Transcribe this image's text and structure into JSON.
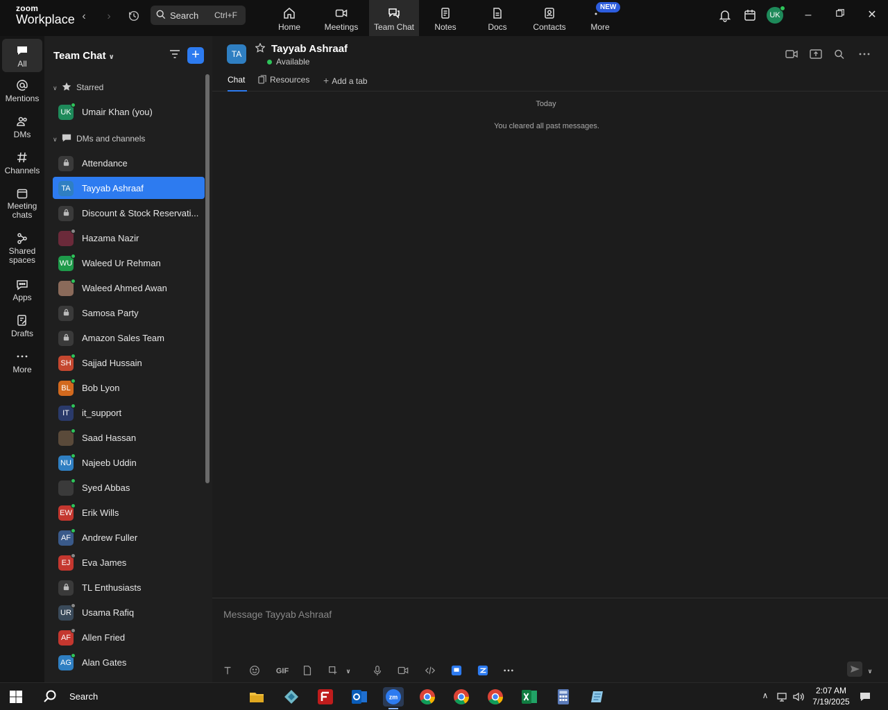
{
  "brand": {
    "line1": "zoom",
    "line2": "Workplace"
  },
  "search": {
    "label": "Search",
    "shortcut": "Ctrl+F"
  },
  "topnav": [
    {
      "label": "Home",
      "icon": "home-icon"
    },
    {
      "label": "Meetings",
      "icon": "video-icon"
    },
    {
      "label": "Team Chat",
      "icon": "chat-icon",
      "active": true
    },
    {
      "label": "Notes",
      "icon": "notes-icon"
    },
    {
      "label": "Docs",
      "icon": "docs-icon"
    },
    {
      "label": "Contacts",
      "icon": "contacts-icon"
    },
    {
      "label": "More",
      "icon": "more-icon"
    }
  ],
  "new_badge": "NEW",
  "user_initials": "UK",
  "rail": [
    {
      "label": "All",
      "icon": "chat-bubble-icon",
      "active": true
    },
    {
      "label": "Mentions",
      "icon": "at-icon"
    },
    {
      "label": "DMs",
      "icon": "people-icon"
    },
    {
      "label": "Channels",
      "icon": "hash-icon"
    },
    {
      "label1": "Meeting",
      "label2": "chats",
      "icon": "calendar-icon"
    },
    {
      "label1": "Shared",
      "label2": "spaces",
      "icon": "share-icon"
    },
    {
      "label": "Apps",
      "icon": "apps-icon"
    },
    {
      "label": "Drafts",
      "icon": "drafts-icon"
    },
    {
      "label": "More",
      "icon": "ellipsis-icon"
    }
  ],
  "list": {
    "title": "Team Chat",
    "starred_label": "Starred",
    "dms_label": "DMs and channels",
    "starred": [
      {
        "name": "Umair Khan (you)",
        "initials": "UK",
        "color": "#1e8a5a",
        "status": "#2ec45a"
      }
    ],
    "items": [
      {
        "name": "Attendance",
        "initials": "",
        "color": "#3a3a3a",
        "type": "channel"
      },
      {
        "name": "Tayyab Ashraaf",
        "initials": "TA",
        "color": "#2f7fc2",
        "selected": true
      },
      {
        "name": "Discount & Stock Reservati...",
        "initials": "",
        "color": "#3a3a3a",
        "type": "channel"
      },
      {
        "name": "Hazama Nazir",
        "initials": "",
        "color": "#6b2a3a",
        "status": "#888888"
      },
      {
        "name": "Waleed Ur Rehman",
        "initials": "WU",
        "color": "#1e9a4a",
        "status": "#2ec45a"
      },
      {
        "name": "Waleed Ahmed Awan",
        "initials": "",
        "color": "#8a6a5a",
        "status": "#2ec45a"
      },
      {
        "name": "Samosa Party",
        "initials": "",
        "color": "#3a3a3a",
        "type": "channel"
      },
      {
        "name": "Amazon Sales Team",
        "initials": "",
        "color": "#3a3a3a",
        "type": "channel"
      },
      {
        "name": "Sajjad Hussain",
        "initials": "SH",
        "color": "#c4472f",
        "status": "#2ec45a"
      },
      {
        "name": "Bob Lyon",
        "initials": "BL",
        "color": "#d2691e",
        "status": "#2ec45a"
      },
      {
        "name": "it_support",
        "initials": "IT",
        "color": "#2a3a6a",
        "status": "#2ec45a"
      },
      {
        "name": "Saad Hassan",
        "initials": "",
        "color": "#5a4a3a",
        "status": "#2ec45a"
      },
      {
        "name": "Najeeb Uddin",
        "initials": "NU",
        "color": "#2f7fc2",
        "status": "#2ec45a"
      },
      {
        "name": "Syed Abbas",
        "initials": "",
        "color": "#3a3a3a",
        "status": "#2ec45a"
      },
      {
        "name": "Erik Wills",
        "initials": "EW",
        "color": "#c4372f",
        "status": "#2ec45a"
      },
      {
        "name": "Andrew Fuller",
        "initials": "AF",
        "color": "#3a5a8a",
        "status": "#2ec45a"
      },
      {
        "name": "Eva James",
        "initials": "EJ",
        "color": "#c4372f",
        "status": "#888888"
      },
      {
        "name": "TL Enthusiasts",
        "initials": "",
        "color": "#3a3a3a",
        "type": "channel"
      },
      {
        "name": "Usama Rafiq",
        "initials": "UR",
        "color": "#3a4a5a",
        "status": "#888888"
      },
      {
        "name": "Allen Fried",
        "initials": "AF",
        "color": "#c4372f",
        "status": "#888888"
      },
      {
        "name": "Alan Gates",
        "initials": "AG",
        "color": "#2f7fc2",
        "status": "#2ec45a"
      }
    ]
  },
  "chat": {
    "initials": "TA",
    "name": "Tayyab Ashraaf",
    "status": "Available",
    "tabs": [
      {
        "label": "Chat",
        "active": true
      },
      {
        "label": "Resources",
        "icon": "resources-icon"
      },
      {
        "label": "Add a tab",
        "icon": "plus-icon"
      }
    ],
    "date_label": "Today",
    "system_message": "You cleared all past messages.",
    "composer_placeholder": "Message Tayyab Ashraaf",
    "gif_label": "GIF"
  },
  "taskbar": {
    "search_label": "Search",
    "time": "2:07 AM",
    "date": "7/19/2025"
  },
  "colors": {
    "accent": "#2d7bf0",
    "online": "#2ec45a"
  }
}
